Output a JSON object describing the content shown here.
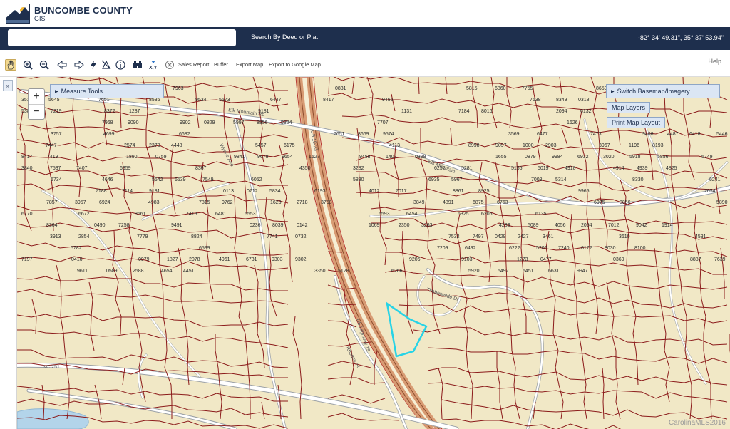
{
  "header": {
    "title": "BUNCOMBE COUNTY",
    "subtitle": "GIS"
  },
  "searchbar": {
    "input_value": "",
    "input_placeholder": "",
    "deed_link": "Search By Deed or Plat",
    "coordinates": "-82° 34' 49.31\", 35° 37' 53.94\""
  },
  "toolbar": {
    "tools": [
      "pan-icon",
      "zoom-in-icon",
      "zoom-out-icon",
      "back-icon",
      "forward-icon",
      "lightning-icon",
      "clear-select-icon",
      "info-icon",
      "binoculars-icon",
      "xy-icon",
      "close-icon"
    ],
    "sales_report": "Sales Report",
    "buffer": "Buffer",
    "export_map": "Export Map",
    "export_google": "Export to Google Map",
    "help": "Help"
  },
  "map": {
    "measure_tools": "Measure Tools",
    "switch_basemap": "Switch Basemap/Imagery",
    "map_layers": "Map Layers",
    "print_layout": "Print Map Layout",
    "zoom_in": "+",
    "zoom_out": "−",
    "credit": "CarolinaMLS2016",
    "parcels": [
      "7963",
      "0831",
      "5815",
      "6860",
      "7755",
      "8659",
      "3534",
      "5645",
      "7651",
      "8536",
      "9534",
      "5573",
      "6447",
      "8417",
      "9456",
      "7638",
      "8349",
      "0318",
      "5381",
      "7219",
      "8372",
      "1237",
      "9181",
      "1131",
      "7184",
      "8016",
      "2094",
      "6132",
      "7968",
      "9090",
      "9902",
      "0829",
      "5997",
      "8856",
      "5824",
      "7707",
      "1626",
      "3757",
      "4699",
      "6682",
      "7651",
      "8669",
      "9574",
      "3569",
      "6477",
      "7473",
      "9406",
      "4487",
      "6418",
      "5446",
      "7447",
      "2574",
      "2378",
      "4448",
      "5457",
      "6175",
      "4113",
      "8998",
      "9097",
      "1000",
      "2903",
      "3967",
      "1196",
      "8193",
      "8417",
      "7419",
      "1890",
      "0759",
      "9841",
      "9678",
      "9654",
      "1527",
      "9458",
      "1407",
      "0388",
      "1655",
      "0879",
      "9984",
      "6932",
      "3020",
      "5918",
      "5856",
      "5749",
      "3840",
      "7537",
      "7407",
      "6359",
      "8367",
      "4350",
      "3282",
      "6252",
      "5281",
      "5155",
      "5019",
      "4918",
      "4914",
      "4939",
      "4825",
      "5734",
      "4646",
      "5642",
      "6539",
      "7549",
      "6052",
      "5880",
      "6935",
      "5967",
      "7008",
      "5314",
      "8330",
      "6241",
      "7188",
      "7114",
      "9181",
      "0113",
      "0712",
      "5834",
      "6193",
      "4012",
      "7017",
      "8861",
      "8925",
      "9965",
      "7054",
      "7857",
      "3957",
      "6924",
      "4983",
      "7815",
      "9762",
      "1623",
      "2718",
      "3758",
      "3849",
      "4891",
      "6875",
      "6763",
      "6975",
      "8856",
      "5890",
      "6770",
      "6672",
      "8661",
      "7418",
      "6481",
      "6553",
      "6593",
      "6454",
      "6325",
      "6205",
      "6135",
      "8364",
      "0490",
      "7258",
      "9491",
      "0236",
      "8039",
      "0142",
      "1069",
      "2350",
      "3263",
      "4283",
      "5089",
      "4056",
      "2054",
      "7012",
      "9042",
      "1914",
      "3913",
      "2854",
      "7779",
      "8824",
      "7741",
      "0732",
      "7532",
      "7497",
      "0429",
      "2427",
      "3461",
      "3610",
      "4531",
      "5782",
      "6599",
      "7209",
      "6492",
      "6222",
      "5200",
      "7240",
      "6172",
      "8030",
      "8100",
      "7197",
      "0416",
      "0979",
      "1827",
      "2078",
      "4961",
      "6731",
      "9303",
      "9302",
      "9206",
      "9103",
      "1273",
      "0477",
      "0369",
      "8887",
      "7639",
      "9611",
      "0589",
      "2588",
      "4654",
      "4451",
      "3350",
      "5128",
      "6266",
      "5920",
      "5492",
      "5451",
      "6631",
      "9947"
    ]
  }
}
